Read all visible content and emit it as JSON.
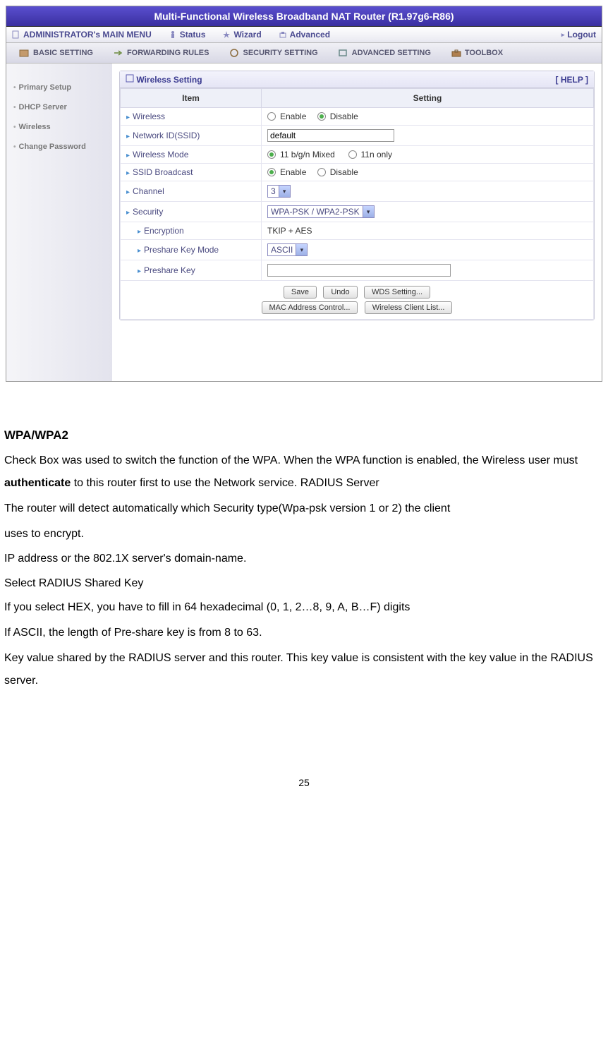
{
  "header": {
    "title": "Multi-Functional Wireless Broadband NAT Router (R1.97g6-R86)"
  },
  "mainmenu": {
    "label": "ADMINISTRATOR's MAIN MENU",
    "status": "Status",
    "wizard": "Wizard",
    "advanced": "Advanced",
    "logout": "Logout"
  },
  "tabs": {
    "basic": "BASIC SETTING",
    "forwarding": "FORWARDING RULES",
    "security": "SECURITY SETTING",
    "advanced": "ADVANCED SETTING",
    "toolbox": "TOOLBOX"
  },
  "sidebar": {
    "items": [
      "Primary Setup",
      "DHCP Server",
      "Wireless",
      "Change Password"
    ]
  },
  "panel": {
    "title": "Wireless Setting",
    "help": "[ HELP ]",
    "col_item": "Item",
    "col_setting": "Setting",
    "rows": {
      "wireless": "Wireless",
      "network_id": "Network ID(SSID)",
      "wireless_mode": "Wireless Mode",
      "ssid_broadcast": "SSID Broadcast",
      "channel": "Channel",
      "security": "Security",
      "encryption": "Encryption",
      "preshare_mode": "Preshare Key Mode",
      "preshare_key": "Preshare Key"
    },
    "values": {
      "enable": "Enable",
      "disable": "Disable",
      "ssid_value": "default",
      "mode_mixed": "11 b/g/n Mixed",
      "mode_11n": "11n only",
      "channel_value": "3",
      "security_value": "WPA-PSK / WPA2-PSK",
      "encryption_value": "TKIP + AES",
      "preshare_mode_value": "ASCII",
      "preshare_key_value": ""
    },
    "buttons": {
      "save": "Save",
      "undo": "Undo",
      "wds": "WDS Setting...",
      "mac": "MAC Address Control...",
      "clients": "Wireless Client List..."
    }
  },
  "doc": {
    "heading": "WPA/WPA2",
    "p1a": "Check Box was used to switch the function of the WPA. When the WPA function is enabled, the Wireless user must ",
    "p1b": "authenticate",
    "p1c": " to this router first to use the Network service. RADIUS Server",
    "p2": "The router will detect automatically    which Security type(Wpa-psk version 1 or 2) the client",
    "p2b": "uses to encrypt.",
    "p3": "IP address or the 802.1X server's domain-name.",
    "p4": "Select RADIUS Shared Key",
    "p5": "If you select HEX, you have to fill in 64 hexadecimal (0, 1, 2…8, 9, A, B…F) digits",
    "p6": "If ASCII, the length of Pre-share key is from 8 to 63.",
    "p7": "Key value shared by the RADIUS server and this router. This key value is consistent with the key value in the RADIUS server.",
    "page": "25"
  }
}
